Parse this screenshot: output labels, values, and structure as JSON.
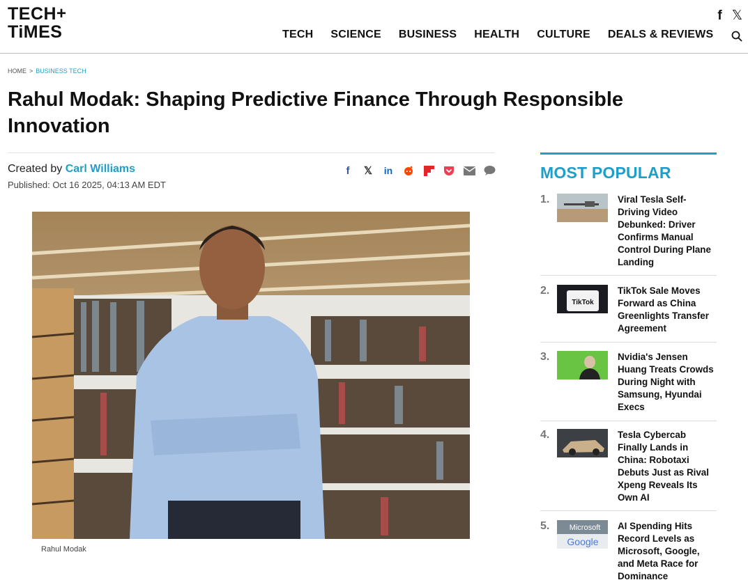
{
  "site": {
    "logo_line1": "TECH",
    "logo_line2": "TiMES",
    "logo_plus": "+",
    "social": [
      {
        "name": "facebook-icon",
        "glyph": "f"
      },
      {
        "name": "x-icon",
        "glyph": "𝕏"
      }
    ]
  },
  "nav": {
    "items": [
      "TECH",
      "SCIENCE",
      "BUSINESS",
      "HEALTH",
      "CULTURE",
      "DEALS & REVIEWS"
    ]
  },
  "breadcrumb": {
    "home": "HOME",
    "separator": ">",
    "current": "BUSINESS TECH"
  },
  "article": {
    "title": "Rahul Modak: Shaping Predictive Finance Through Responsible Innovation",
    "created_by_label": "Created by",
    "author": "Carl Williams",
    "published": "Published: Oct 16 2025, 04:13 AM EDT",
    "image_caption": "Rahul Modak"
  },
  "share_icons": [
    "facebook-icon",
    "x-icon",
    "linkedin-icon",
    "reddit-icon",
    "flipboard-icon",
    "pocket-icon",
    "email-icon",
    "comment-icon"
  ],
  "colors": {
    "accent": "#1f9ec8",
    "text": "#111111"
  },
  "most_popular": {
    "heading": "MOST POPULAR",
    "items": [
      {
        "num": "1.",
        "title": "Viral Tesla Self-Driving Video Debunked: Driver Confirms Manual Control During Plane Landing"
      },
      {
        "num": "2.",
        "title": "TikTok Sale Moves Forward as China Greenlights Transfer Agreement",
        "thumb_text": "TikTok"
      },
      {
        "num": "3.",
        "title": "Nvidia's Jensen Huang Treats Crowds During Night with Samsung, Hyundai Execs"
      },
      {
        "num": "4.",
        "title": "Tesla Cybercab Finally Lands in China: Robotaxi Debuts Just as Rival Xpeng Reveals Its Own AI"
      },
      {
        "num": "5.",
        "title": "AI Spending Hits Record Levels as Microsoft, Google, and Meta Race for Dominance",
        "thumb_text_1": "Microsoft",
        "thumb_text_2": "Google"
      }
    ]
  }
}
